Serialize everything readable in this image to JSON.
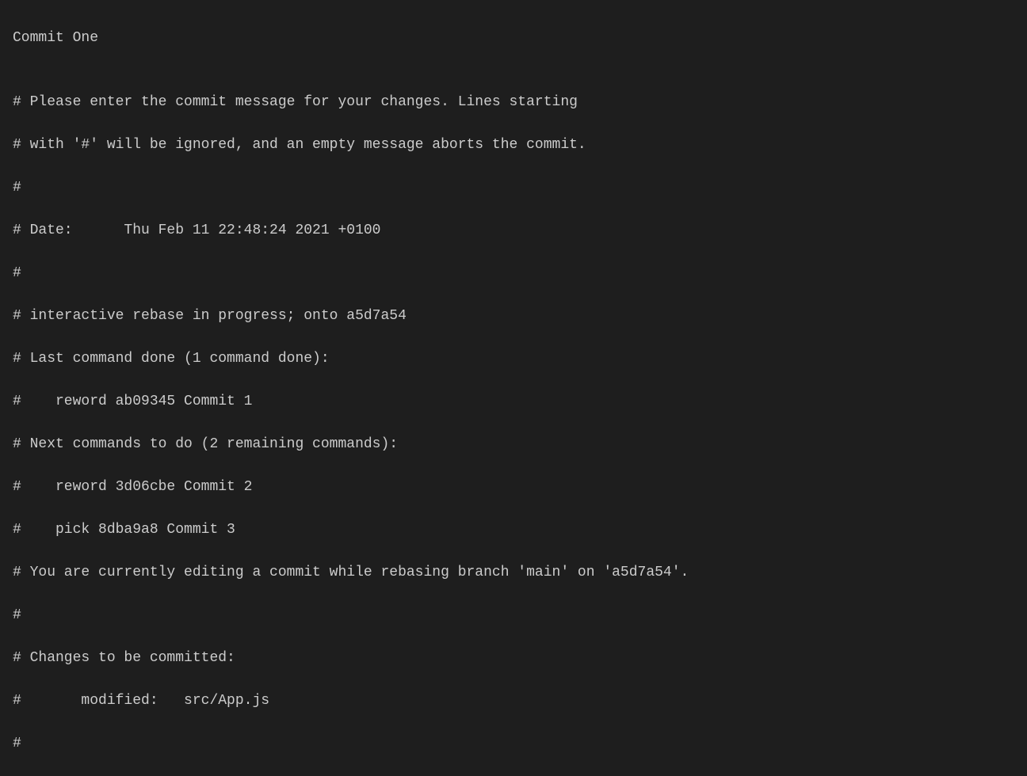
{
  "editor": {
    "commit_message": "Commit One",
    "blank_line": "",
    "comments": {
      "line1": "# Please enter the commit message for your changes. Lines starting",
      "line2": "# with '#' will be ignored, and an empty message aborts the commit.",
      "line3": "#",
      "line4": "# Date:      Thu Feb 11 22:48:24 2021 +0100",
      "line5": "#",
      "line6": "# interactive rebase in progress; onto a5d7a54",
      "line7": "# Last command done (1 command done):",
      "line8": "#    reword ab09345 Commit 1",
      "line9": "# Next commands to do (2 remaining commands):",
      "line10": "#    reword 3d06cbe Commit 2",
      "line11": "#    pick 8dba9a8 Commit 3",
      "line12": "# You are currently editing a commit while rebasing branch 'main' on 'a5d7a54'.",
      "line13": "#",
      "line14": "# Changes to be committed:",
      "line15": "#       modified:   src/App.js",
      "line16": "#"
    }
  }
}
